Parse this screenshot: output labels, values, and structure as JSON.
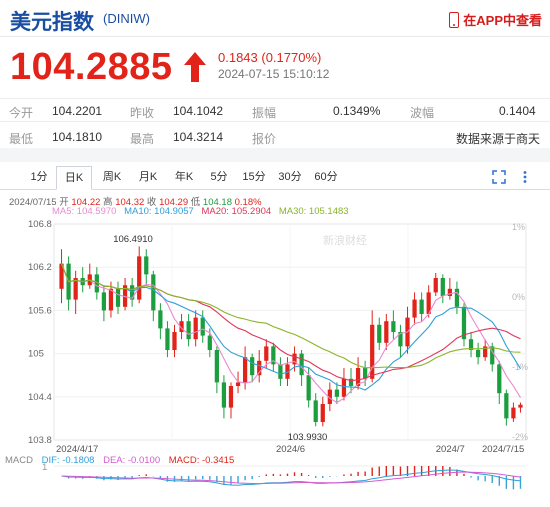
{
  "header": {
    "title": "美元指数",
    "code": "(DINIW)",
    "app_link": "在APP中查看"
  },
  "quote": {
    "price": "104.2885",
    "change": "0.1843 (0.1770%)",
    "time": "2024-07-15 15:10:12"
  },
  "stats": {
    "row1": [
      {
        "label": "今开",
        "value": "104.2201"
      },
      {
        "label": "昨收",
        "value": "104.1042"
      },
      {
        "label": "振幅",
        "value": "0.1349%"
      },
      {
        "label": "波幅",
        "value": "0.1404"
      }
    ],
    "row2": [
      {
        "label": "最低",
        "value": "104.1810"
      },
      {
        "label": "最高",
        "value": "104.3214"
      },
      {
        "label": "报价",
        "value": ""
      },
      {
        "label": "",
        "value": "数据来源于商天"
      }
    ]
  },
  "tabs": [
    "1分",
    "日K",
    "周K",
    "月K",
    "年K",
    "5分",
    "15分",
    "30分",
    "60分"
  ],
  "active_tab": "日K",
  "ohlc": {
    "date": "2024/07/15",
    "open_label": "开",
    "open": "104.22",
    "high_label": "高",
    "high": "104.32",
    "close_label": "收",
    "close": "104.29",
    "low_label": "低",
    "low": "104.18",
    "pct": "0.18%"
  },
  "ma_legend": [
    {
      "label": "MA5: 104.5970",
      "color": "#e88bd0"
    },
    {
      "label": "MA10: 104.9057",
      "color": "#2e9fd8"
    },
    {
      "label": "MA20: 105.2904",
      "color": "#e0355a"
    },
    {
      "label": "MA30: 105.1483",
      "color": "#8ab42a"
    }
  ],
  "macd_legend": [
    {
      "label": "MACD",
      "color": "#888888"
    },
    {
      "label": "DIF: -0.1808",
      "color": "#2e9fd8"
    },
    {
      "label": "DEA: -0.0100",
      "color": "#d45bd0"
    },
    {
      "label": "MACD: -0.3415",
      "color": "#e2231a"
    }
  ],
  "chart_data": {
    "type": "candlestick",
    "y_ticks": [
      "106.8",
      "106.2",
      "105.6",
      "105",
      "104.4",
      "103.8"
    ],
    "ylim": [
      103.8,
      106.8
    ],
    "pct_ticks": [
      "1%",
      "0%",
      "-1%",
      "-2%"
    ],
    "x_ticks": [
      "2024/4/17",
      "2024/6",
      "2024/7",
      "2024/7/15"
    ],
    "annotations": [
      {
        "label": "106.4910",
        "value": 106.491
      },
      {
        "label": "103.9930",
        "value": 103.993
      }
    ],
    "macd_tick": "1",
    "watermark": "新浪财经",
    "candles": [
      {
        "o": 105.9,
        "c": 106.25,
        "h": 106.45,
        "l": 105.7
      },
      {
        "o": 106.25,
        "c": 105.75,
        "h": 106.35,
        "l": 105.6
      },
      {
        "o": 105.75,
        "c": 106.05,
        "h": 106.15,
        "l": 105.55
      },
      {
        "o": 106.05,
        "c": 105.95,
        "h": 106.2,
        "l": 105.85
      },
      {
        "o": 105.95,
        "c": 106.1,
        "h": 106.25,
        "l": 105.9
      },
      {
        "o": 106.1,
        "c": 105.85,
        "h": 106.2,
        "l": 105.75
      },
      {
        "o": 105.85,
        "c": 105.6,
        "h": 105.95,
        "l": 105.45
      },
      {
        "o": 105.6,
        "c": 105.9,
        "h": 106.0,
        "l": 105.5
      },
      {
        "o": 105.9,
        "c": 105.65,
        "h": 106.0,
        "l": 105.55
      },
      {
        "o": 105.65,
        "c": 105.95,
        "h": 106.05,
        "l": 105.6
      },
      {
        "o": 105.95,
        "c": 105.75,
        "h": 106.05,
        "l": 105.65
      },
      {
        "o": 105.75,
        "c": 106.35,
        "h": 106.49,
        "l": 105.7
      },
      {
        "o": 106.35,
        "c": 106.1,
        "h": 106.45,
        "l": 105.95
      },
      {
        "o": 106.1,
        "c": 105.6,
        "h": 106.15,
        "l": 105.45
      },
      {
        "o": 105.6,
        "c": 105.35,
        "h": 105.7,
        "l": 105.2
      },
      {
        "o": 105.35,
        "c": 105.05,
        "h": 105.45,
        "l": 104.95
      },
      {
        "o": 105.05,
        "c": 105.3,
        "h": 105.4,
        "l": 104.95
      },
      {
        "o": 105.3,
        "c": 105.45,
        "h": 105.55,
        "l": 105.2
      },
      {
        "o": 105.45,
        "c": 105.2,
        "h": 105.55,
        "l": 105.1
      },
      {
        "o": 105.2,
        "c": 105.5,
        "h": 105.6,
        "l": 105.1
      },
      {
        "o": 105.5,
        "c": 105.25,
        "h": 105.6,
        "l": 105.15
      },
      {
        "o": 105.25,
        "c": 105.05,
        "h": 105.35,
        "l": 104.95
      },
      {
        "o": 105.05,
        "c": 104.6,
        "h": 105.1,
        "l": 104.45
      },
      {
        "o": 104.6,
        "c": 104.25,
        "h": 104.7,
        "l": 104.1
      },
      {
        "o": 104.25,
        "c": 104.55,
        "h": 104.6,
        "l": 104.1
      },
      {
        "o": 104.55,
        "c": 104.6,
        "h": 104.75,
        "l": 104.45
      },
      {
        "o": 104.6,
        "c": 104.95,
        "h": 105.1,
        "l": 104.5
      },
      {
        "o": 104.95,
        "c": 104.7,
        "h": 105.0,
        "l": 104.6
      },
      {
        "o": 104.7,
        "c": 104.9,
        "h": 105.05,
        "l": 104.6
      },
      {
        "o": 104.9,
        "c": 105.1,
        "h": 105.2,
        "l": 104.8
      },
      {
        "o": 105.1,
        "c": 104.85,
        "h": 105.15,
        "l": 104.75
      },
      {
        "o": 104.85,
        "c": 104.65,
        "h": 104.95,
        "l": 104.55
      },
      {
        "o": 104.65,
        "c": 104.85,
        "h": 104.95,
        "l": 104.55
      },
      {
        "o": 104.85,
        "c": 105.0,
        "h": 105.1,
        "l": 104.75
      },
      {
        "o": 105.0,
        "c": 104.7,
        "h": 105.05,
        "l": 104.55
      },
      {
        "o": 104.7,
        "c": 104.35,
        "h": 104.8,
        "l": 104.25
      },
      {
        "o": 104.35,
        "c": 104.05,
        "h": 104.45,
        "l": 103.99
      },
      {
        "o": 104.05,
        "c": 104.3,
        "h": 104.4,
        "l": 103.99
      },
      {
        "o": 104.3,
        "c": 104.5,
        "h": 104.6,
        "l": 104.2
      },
      {
        "o": 104.5,
        "c": 104.4,
        "h": 104.6,
        "l": 104.3
      },
      {
        "o": 104.4,
        "c": 104.65,
        "h": 104.8,
        "l": 104.35
      },
      {
        "o": 104.65,
        "c": 104.55,
        "h": 104.8,
        "l": 104.45
      },
      {
        "o": 104.55,
        "c": 104.8,
        "h": 104.95,
        "l": 104.5
      },
      {
        "o": 104.8,
        "c": 104.65,
        "h": 104.9,
        "l": 104.55
      },
      {
        "o": 104.65,
        "c": 105.4,
        "h": 105.6,
        "l": 104.6
      },
      {
        "o": 105.4,
        "c": 105.15,
        "h": 105.5,
        "l": 105.05
      },
      {
        "o": 105.15,
        "c": 105.45,
        "h": 105.55,
        "l": 105.05
      },
      {
        "o": 105.45,
        "c": 105.3,
        "h": 105.6,
        "l": 105.2
      },
      {
        "o": 105.3,
        "c": 105.1,
        "h": 105.4,
        "l": 104.95
      },
      {
        "o": 105.1,
        "c": 105.5,
        "h": 105.65,
        "l": 105.0
      },
      {
        "o": 105.5,
        "c": 105.75,
        "h": 105.85,
        "l": 105.4
      },
      {
        "o": 105.75,
        "c": 105.55,
        "h": 105.85,
        "l": 105.45
      },
      {
        "o": 105.55,
        "c": 105.85,
        "h": 105.95,
        "l": 105.5
      },
      {
        "o": 105.85,
        "c": 106.05,
        "h": 106.12,
        "l": 105.8
      },
      {
        "o": 106.05,
        "c": 105.8,
        "h": 106.1,
        "l": 105.7
      },
      {
        "o": 105.8,
        "c": 105.9,
        "h": 106.05,
        "l": 105.75
      },
      {
        "o": 105.9,
        "c": 105.65,
        "h": 106.0,
        "l": 105.55
      },
      {
        "o": 105.65,
        "c": 105.2,
        "h": 105.7,
        "l": 105.1
      },
      {
        "o": 105.2,
        "c": 105.05,
        "h": 105.3,
        "l": 104.95
      },
      {
        "o": 105.05,
        "c": 104.95,
        "h": 105.15,
        "l": 104.85
      },
      {
        "o": 104.95,
        "c": 105.1,
        "h": 105.2,
        "l": 104.9
      },
      {
        "o": 105.1,
        "c": 104.85,
        "h": 105.15,
        "l": 104.75
      },
      {
        "o": 104.85,
        "c": 104.45,
        "h": 104.9,
        "l": 104.3
      },
      {
        "o": 104.45,
        "c": 104.1,
        "h": 104.5,
        "l": 104.0
      },
      {
        "o": 104.1,
        "c": 104.25,
        "h": 104.32,
        "l": 104.05
      },
      {
        "o": 104.25,
        "c": 104.29,
        "h": 104.32,
        "l": 104.18
      }
    ]
  }
}
